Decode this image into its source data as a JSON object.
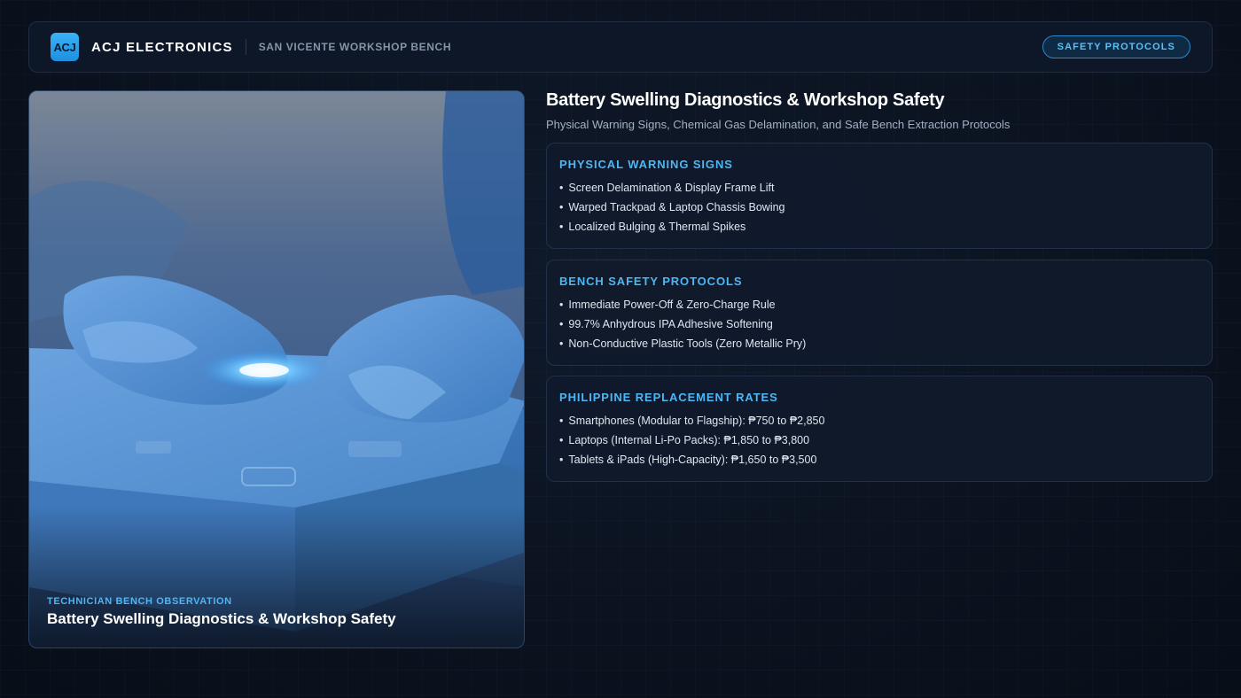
{
  "header": {
    "logo_text": "ACJ",
    "brand": "ACJ ELECTRONICS",
    "location": "SAN VICENTE WORKSHOP BENCH",
    "safety_button": "SAFETY PROTOCOLS"
  },
  "image_card": {
    "tag": "TECHNICIAN BENCH OBSERVATION",
    "title": "Battery Swelling Diagnostics & Workshop Safety"
  },
  "main": {
    "title": "Battery Swelling Diagnostics & Workshop Safety",
    "subtitle": "Physical Warning Signs, Chemical Gas Delamination, and Safe Bench Extraction Protocols",
    "panels": [
      {
        "title": "PHYSICAL WARNING SIGNS",
        "items": [
          "Screen Delamination & Display Frame Lift",
          "Warped Trackpad & Laptop Chassis Bowing",
          "Localized Bulging & Thermal Spikes"
        ]
      },
      {
        "title": "BENCH SAFETY PROTOCOLS",
        "items": [
          "Immediate Power-Off & Zero-Charge Rule",
          "99.7% Anhydrous IPA Adhesive Softening",
          "Non-Conductive Plastic Tools (Zero Metallic Pry)"
        ]
      },
      {
        "title": "PHILIPPINE REPLACEMENT RATES",
        "items": [
          "Smartphones (Modular to Flagship): ₱750 to ₱2,850",
          "Laptops (Internal Li-Po Packs): ₱1,850 to ₱3,800",
          "Tablets & iPads (High-Capacity): ₱1,650 to ₱3,500"
        ]
      }
    ]
  },
  "colors": {
    "accent": "#4eb6f2",
    "background": "#0b1220",
    "panel": "#101a2b"
  }
}
